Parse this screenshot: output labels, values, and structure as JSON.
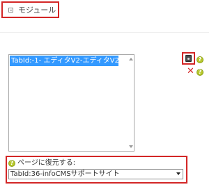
{
  "module": {
    "title": "モジュール"
  },
  "listbox": {
    "options": [
      "TabId:-1- エディタV2-エディタV2"
    ]
  },
  "actions": {
    "help_mark": "?",
    "delete_mark": "✕"
  },
  "restore": {
    "label": "ページに復元する:",
    "selected_page": "TabId:36-infoCMSサポートサイト"
  },
  "colors": {
    "highlight": "#d32626",
    "selection": "#3399ff",
    "help": "#b7c82d"
  },
  "icons": {
    "collapse": "collapse-icon",
    "restore": "restore-icon",
    "help": "help-icon",
    "delete": "delete-icon"
  }
}
